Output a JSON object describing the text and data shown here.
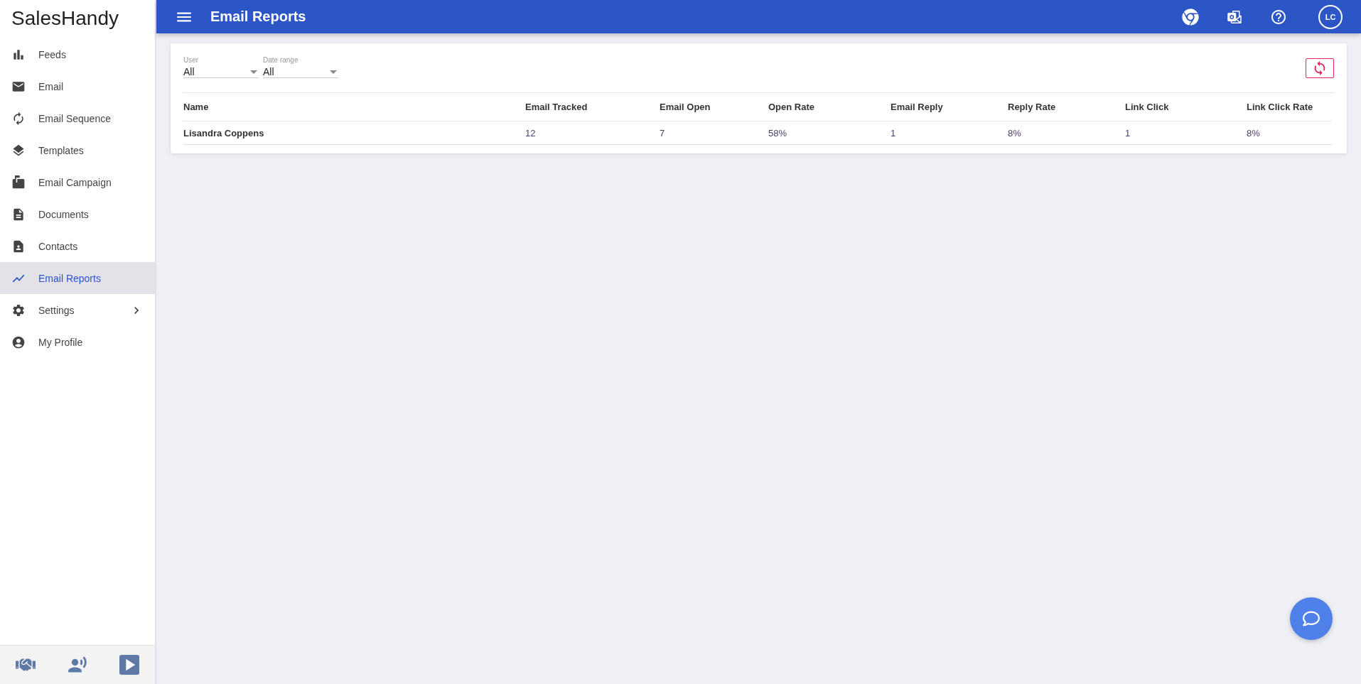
{
  "brand": {
    "bold": "Sales",
    "light": "Handy"
  },
  "sidebar": {
    "items": [
      {
        "label": "Feeds",
        "selected": false,
        "submenu": false
      },
      {
        "label": "Email",
        "selected": false,
        "submenu": false
      },
      {
        "label": "Email Sequence",
        "selected": false,
        "submenu": false
      },
      {
        "label": "Templates",
        "selected": false,
        "submenu": false
      },
      {
        "label": "Email Campaign",
        "selected": false,
        "submenu": false
      },
      {
        "label": "Documents",
        "selected": false,
        "submenu": false
      },
      {
        "label": "Contacts",
        "selected": false,
        "submenu": false
      },
      {
        "label": "Email Reports",
        "selected": true,
        "submenu": false
      },
      {
        "label": "Settings",
        "selected": false,
        "submenu": true
      },
      {
        "label": "My Profile",
        "selected": false,
        "submenu": false
      }
    ]
  },
  "header": {
    "title": "Email Reports",
    "avatar": "LC"
  },
  "filters": [
    {
      "label": "User",
      "value": "All"
    },
    {
      "label": "Date range",
      "value": "All"
    }
  ],
  "table": {
    "columns": [
      "Name",
      "Email Tracked",
      "Email Open",
      "Open Rate",
      "Email Reply",
      "Reply Rate",
      "Link Click",
      "Link Click Rate"
    ],
    "rows": [
      [
        "Lisandra Coppens",
        "12",
        "7",
        "58%",
        "1",
        "8%",
        "1",
        "8%"
      ]
    ]
  }
}
